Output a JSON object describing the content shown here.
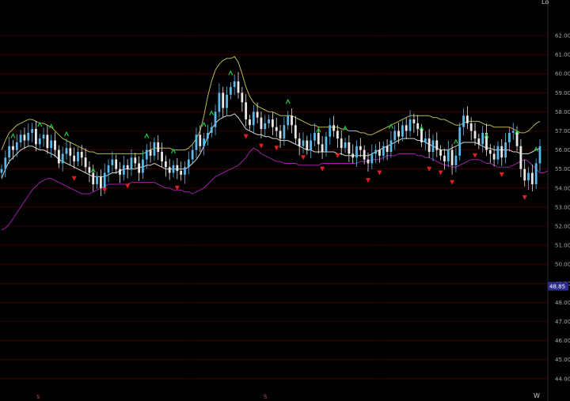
{
  "chart_data": {
    "type": "line",
    "title": "",
    "xlabel": "",
    "ylabel": "",
    "ylim": [
      43.4,
      62.6
    ],
    "y_ticks": [
      "62.00",
      "61.00",
      "60.00",
      "59.00",
      "58.00",
      "57.00",
      "56.00",
      "55.00",
      "54.00",
      "53.00",
      "52.00",
      "51.00",
      "50.00",
      "49.00",
      "48.00",
      "47.00",
      "46.00",
      "45.00",
      "44.00"
    ],
    "last_price": "48.85",
    "last_price_color": "#2c2c8c",
    "x_markers": [
      "S",
      "S"
    ],
    "corner_glyph": "Lo",
    "bottom_right_glyph": "W",
    "grid": true,
    "colors": {
      "background": "#000000",
      "grid": "#5a0000",
      "candle_up": "#58b8e8",
      "candle_down": "#e8e8e8",
      "upper_band": "#b8b850",
      "middle_band": "#d8d8c8",
      "lower_band": "#a020a8",
      "buy_signal": "#20c840",
      "sell_signal": "#e02020"
    },
    "series": [
      {
        "values": [
          55.0,
          55.6,
          56.2,
          56.0,
          56.4,
          56.8,
          56.5,
          56.9,
          57.1,
          56.3,
          56.6,
          56.8,
          56.1,
          56.5,
          56.0,
          55.3,
          55.8,
          56.1,
          55.7,
          55.4,
          55.9,
          55.6,
          55.1,
          54.8,
          54.2,
          54.6,
          54.0,
          54.8,
          55.2,
          55.5,
          55.0,
          54.7,
          55.2,
          55.0,
          55.6,
          55.3,
          54.8,
          55.5,
          56.0,
          55.7,
          56.4,
          55.9,
          55.4,
          55.1,
          54.8,
          55.2,
          54.9,
          54.7,
          55.1,
          55.5,
          56.0,
          56.8,
          56.2,
          56.6,
          56.9,
          57.2,
          58.0,
          59.0,
          58.2,
          58.9,
          59.3,
          59.6,
          59.0,
          58.5,
          57.6,
          57.3,
          58.0,
          57.7,
          57.1,
          57.4,
          57.6,
          57.2,
          57.0,
          56.6,
          57.3,
          57.8,
          57.3,
          56.6,
          56.2,
          56.5,
          56.0,
          56.5,
          56.9,
          56.3,
          55.9,
          56.7,
          57.3,
          57.0,
          56.6,
          56.1,
          56.4,
          55.8,
          55.6,
          56.2,
          56.0,
          55.5,
          55.3,
          55.8,
          56.0,
          55.7,
          56.2,
          55.9,
          56.5,
          57.0,
          56.7,
          57.3,
          57.0,
          57.6,
          57.4,
          57.1,
          56.4,
          56.6,
          55.9,
          56.5,
          56.0,
          55.7,
          55.4,
          56.0,
          55.2,
          55.7,
          57.2,
          57.8,
          57.4,
          57.0,
          56.6,
          56.3,
          56.9,
          56.0,
          55.8,
          55.5,
          56.2,
          55.6,
          56.4,
          56.9,
          57.0,
          56.2,
          55.0,
          54.4,
          54.8,
          54.2,
          55.3,
          56.2
        ]
      },
      {
        "name": "upper-band",
        "values": [
          56.0,
          56.5,
          56.9,
          57.1,
          57.3,
          57.4,
          57.5,
          57.6,
          57.6,
          57.5,
          57.4,
          57.4,
          57.3,
          57.2,
          57.0,
          56.8,
          56.6,
          56.5,
          56.4,
          56.3,
          56.2,
          56.1,
          56.0,
          55.9,
          55.9,
          55.8,
          55.8,
          55.8,
          55.8,
          55.8,
          55.8,
          55.8,
          55.8,
          55.8,
          55.8,
          55.8,
          55.8,
          55.8,
          55.9,
          56.0,
          56.1,
          56.1,
          56.1,
          56.1,
          56.1,
          56.0,
          56.0,
          56.0,
          56.0,
          56.1,
          56.3,
          56.6,
          57.0,
          57.8,
          58.8,
          59.6,
          60.2,
          60.5,
          60.7,
          60.8,
          60.8,
          60.9,
          60.6,
          60.0,
          59.3,
          58.8,
          58.5,
          58.3,
          58.2,
          58.1,
          58.0,
          58.0,
          57.9,
          57.8,
          57.8,
          57.8,
          57.8,
          57.7,
          57.6,
          57.5,
          57.4,
          57.3,
          57.3,
          57.2,
          57.2,
          57.2,
          57.2,
          57.2,
          57.2,
          57.1,
          57.1,
          57.0,
          57.0,
          57.0,
          56.9,
          56.9,
          56.8,
          56.8,
          56.9,
          57.0,
          57.1,
          57.2,
          57.3,
          57.4,
          57.5,
          57.6,
          57.7,
          57.8,
          57.8,
          57.8,
          57.8,
          57.8,
          57.8,
          57.7,
          57.7,
          57.6,
          57.6,
          57.5,
          57.4,
          57.3,
          57.3,
          57.4,
          57.5,
          57.5,
          57.5,
          57.5,
          57.4,
          57.3,
          57.3,
          57.2,
          57.2,
          57.2,
          57.2,
          57.2,
          57.1,
          57.0,
          56.9,
          56.9,
          57.0,
          57.2,
          57.4,
          57.5
        ]
      },
      {
        "name": "middle-band",
        "values": [
          54.5,
          55.0,
          55.4,
          55.6,
          55.8,
          56.0,
          56.1,
          56.2,
          56.2,
          56.1,
          56.0,
          56.0,
          55.9,
          55.8,
          55.7,
          55.5,
          55.4,
          55.3,
          55.2,
          55.1,
          55.0,
          54.9,
          54.8,
          54.7,
          54.6,
          54.6,
          54.6,
          54.6,
          54.7,
          54.8,
          54.8,
          54.9,
          55.0,
          55.0,
          55.0,
          55.0,
          55.1,
          55.1,
          55.2,
          55.2,
          55.3,
          55.2,
          55.1,
          55.0,
          55.0,
          55.0,
          55.0,
          55.0,
          55.0,
          55.1,
          55.3,
          55.5,
          55.8,
          56.2,
          56.7,
          57.1,
          57.4,
          57.6,
          57.7,
          57.8,
          57.8,
          57.9,
          57.7,
          57.4,
          57.1,
          57.0,
          56.9,
          56.8,
          56.8,
          56.7,
          56.7,
          56.6,
          56.6,
          56.5,
          56.5,
          56.5,
          56.4,
          56.3,
          56.2,
          56.1,
          56.0,
          56.0,
          55.9,
          55.9,
          55.9,
          55.9,
          55.9,
          55.9,
          55.8,
          55.8,
          55.7,
          55.7,
          55.7,
          55.7,
          55.7,
          55.7,
          55.7,
          55.8,
          55.9,
          56.0,
          56.1,
          56.2,
          56.3,
          56.4,
          56.5,
          56.6,
          56.6,
          56.6,
          56.6,
          56.5,
          56.5,
          56.4,
          56.3,
          56.2,
          56.1,
          56.0,
          56.0,
          56.0,
          56.1,
          56.2,
          56.3,
          56.4,
          56.4,
          56.4,
          56.4,
          56.3,
          56.2,
          56.1,
          56.1,
          56.0,
          56.0,
          56.0,
          56.0,
          56.0,
          55.9,
          55.9,
          55.8,
          55.8,
          55.8,
          55.9,
          56.0,
          56.1
        ]
      },
      {
        "name": "lower-band",
        "values": [
          51.8,
          51.9,
          52.1,
          52.4,
          52.7,
          53.0,
          53.3,
          53.6,
          53.9,
          54.1,
          54.3,
          54.4,
          54.5,
          54.5,
          54.4,
          54.3,
          54.2,
          54.1,
          54.0,
          53.9,
          53.8,
          53.7,
          53.7,
          53.7,
          53.8,
          53.9,
          54.0,
          54.1,
          54.2,
          54.2,
          54.2,
          54.2,
          54.2,
          54.2,
          54.3,
          54.3,
          54.3,
          54.3,
          54.3,
          54.3,
          54.3,
          54.2,
          54.1,
          54.0,
          54.0,
          53.9,
          53.9,
          53.9,
          53.8,
          53.8,
          53.7,
          53.8,
          53.9,
          54.0,
          54.2,
          54.4,
          54.6,
          54.7,
          54.8,
          54.9,
          55.0,
          55.1,
          55.2,
          55.4,
          55.6,
          55.9,
          56.1,
          56.0,
          55.8,
          55.7,
          55.6,
          55.5,
          55.4,
          55.4,
          55.3,
          55.3,
          55.3,
          55.3,
          55.2,
          55.2,
          55.2,
          55.2,
          55.2,
          55.2,
          55.3,
          55.3,
          55.3,
          55.3,
          55.3,
          55.3,
          55.3,
          55.3,
          55.3,
          55.3,
          55.4,
          55.4,
          55.4,
          55.5,
          55.5,
          55.5,
          55.6,
          55.7,
          55.7,
          55.7,
          55.8,
          55.8,
          55.8,
          55.8,
          55.8,
          55.7,
          55.7,
          55.6,
          55.6,
          55.5,
          55.4,
          55.3,
          55.2,
          55.2,
          55.1,
          55.1,
          55.2,
          55.3,
          55.4,
          55.5,
          55.5,
          55.5,
          55.4,
          55.3,
          55.3,
          55.2,
          55.1,
          55.1,
          55.1,
          55.1,
          55.2,
          55.3,
          55.4,
          55.5,
          55.4,
          55.2,
          55.0,
          54.8,
          54.8,
          54.9
        ]
      }
    ],
    "buy_signals": [
      3,
      10,
      13,
      17,
      24,
      38,
      45,
      53,
      55,
      60,
      75,
      83,
      90,
      102,
      110,
      119,
      127,
      135,
      140
    ],
    "sell_signals": [
      19,
      27,
      33,
      46,
      64,
      68,
      72,
      79,
      84,
      88,
      96,
      99,
      112,
      115,
      118,
      124,
      131,
      137
    ]
  }
}
